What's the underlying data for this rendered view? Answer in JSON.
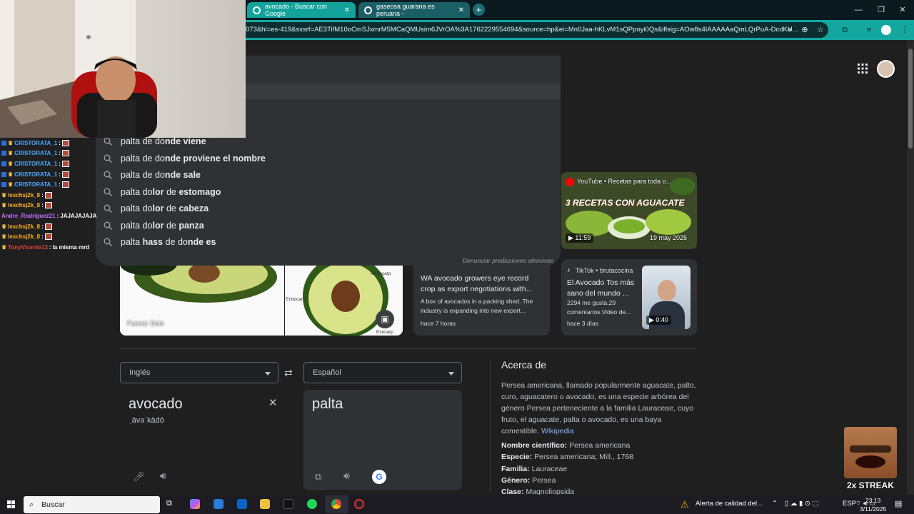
{
  "browser": {
    "tabs": [
      {
        "label": "avocado - Buscar con Google",
        "active": true
      },
      {
        "label": "gaseosa guarana es peruana - ",
        "active": false
      }
    ],
    "url": "073&hl=es-419&sxsrf=AE3TifM10oCmSJxmrM5MCaQMUsim6JVrOA%3A1762229554694&source=hp&ei=Mn0Jaa-hKLvM1sQPpoyi0Qs&iflsig=AOw8s4IAAAAAaQmLQrPuA-DcdKU..."
  },
  "chat": [
    {
      "user": "CRISTORATA_1",
      "color": "blue",
      "msg": ""
    },
    {
      "user": "CRISTORATA_1",
      "color": "blue",
      "msg": ""
    },
    {
      "user": "CRISTORATA_1",
      "color": "blue",
      "msg": ""
    },
    {
      "user": "CRISTORATA_1",
      "color": "blue",
      "msg": ""
    },
    {
      "user": "CRISTORATA_1",
      "color": "blue",
      "msg": ""
    },
    {
      "user": "lexchsj2k_8",
      "color": "orange",
      "msg": ""
    },
    {
      "user": "lexchsj2k_8",
      "color": "orange",
      "msg": ""
    },
    {
      "user": "Andre_Rodriguez21",
      "color": "purple",
      "msg": "JAJAJAJAJA"
    },
    {
      "user": "lexchsj2k_8",
      "color": "orange",
      "msg": ""
    },
    {
      "user": "lexchsj2k_8",
      "color": "orange",
      "msg": ""
    },
    {
      "user": "TonyVicente13",
      "color": "red",
      "msg": "la misma mrd"
    }
  ],
  "suggestions": [
    {
      "plain": "palta de do",
      "bold": "nde viene",
      "tail": ""
    },
    {
      "plain": "palta de do",
      "bold": "nde proviene el nombre",
      "tail": ""
    },
    {
      "plain": "palta de do",
      "bold": "nde sale",
      "tail": ""
    },
    {
      "plain": "palta do",
      "bold": "lor",
      "tail": " de ",
      "bold2": "estomago"
    },
    {
      "plain": "palta do",
      "bold": "lor",
      "tail": " de ",
      "bold2": "cabeza"
    },
    {
      "plain": "palta do",
      "bold": "lor",
      "tail": " de ",
      "bold2": "panza"
    },
    {
      "plain": "palta ",
      "bold": "hass",
      "tail": " de do",
      "bold2": "nde es"
    }
  ],
  "report_label": "Denunciar predicciones ofensivas",
  "image_card": {
    "source": "Fuente: Dole",
    "labels": [
      "Mesocarp",
      "Endocarp",
      "Exocarp"
    ]
  },
  "youtube_card": {
    "source": "YouTube • Recetas para toda o...",
    "banner": "3 RECETAS CON AGUACATE",
    "duration": "11:59",
    "date": "19 may 2025"
  },
  "news_card": {
    "title": "WA avocado growers eye record crop as export negotiations with...",
    "snippet": "A box of avocados in a packing shed. The industry is expanding into new export...",
    "time": "hace 7 horas"
  },
  "tiktok_card": {
    "source": "TikTok • brutacocina",
    "title": "El Avocado Tos más sano del mundo ...",
    "stats": "2294 me gusta,29 comentarios.Video de...",
    "time": "hace 3 días",
    "duration": "0:40"
  },
  "translate": {
    "source_lang": "Inglés",
    "target_lang": "Español",
    "source_text": "avocado",
    "phonetic": "ˌävəˈkädō",
    "target_text": "palta"
  },
  "about": {
    "heading": "Acerca de",
    "text": "Persea americana, llamado popularmente aguacate,  palto,  curo,  aguacatero  o avocado,  es una especie arbórea del género Persea perteneciente a la familia Lauraceae, cuyo fruto, el aguacate,  palta o avocado,  es una baya comestible.",
    "link": "Wikipedia",
    "facts": [
      {
        "label": "Nombre científico:",
        "value": "Persea americana"
      },
      {
        "label": "Especie:",
        "value": "Persea americana; Mill., 1768"
      },
      {
        "label": "Familia:",
        "value": "Lauraceae"
      },
      {
        "label": "Género:",
        "value": "Persea"
      },
      {
        "label": "Clase:",
        "value": "Magnoliopsida"
      }
    ]
  },
  "overlay": {
    "streak": "2x STREAK"
  },
  "taskbar": {
    "search_placeholder": "Buscar",
    "alert": "Alerta de calidad del...",
    "lang": "ESP",
    "time": "23:13",
    "date": "3/11/2025"
  }
}
